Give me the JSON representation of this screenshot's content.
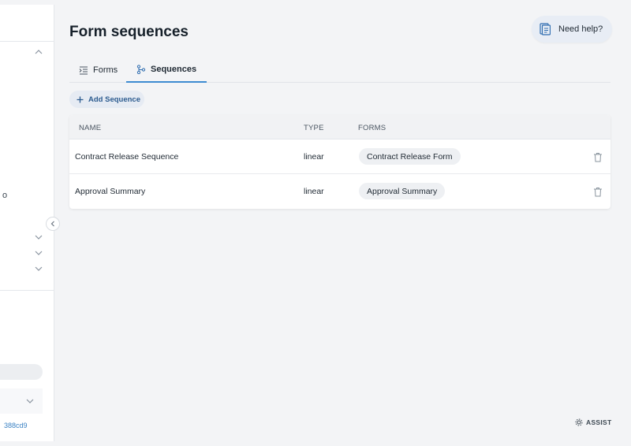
{
  "page": {
    "title": "Form sequences",
    "help_label": "Need help?",
    "assist_label": "ASSIST"
  },
  "sidebar": {
    "fragment_text": "o",
    "link_fragment": "388cd9"
  },
  "tabs": [
    {
      "label": "Forms",
      "icon": "forms-list-icon",
      "active": false
    },
    {
      "label": "Sequences",
      "icon": "sequence-tree-icon",
      "active": true
    }
  ],
  "toolbar": {
    "add_label": "Add Sequence"
  },
  "table": {
    "columns": [
      "NAME",
      "TYPE",
      "FORMS"
    ],
    "rows": [
      {
        "name": "Contract Release Sequence",
        "type": "linear",
        "form": "Contract Release Form"
      },
      {
        "name": "Approval Summary",
        "type": "linear",
        "form": "Approval Summary"
      }
    ]
  },
  "colors": {
    "accent": "#3d8bd1",
    "chip_bg": "#eef0f3",
    "button_bg": "#e6ebf3"
  }
}
